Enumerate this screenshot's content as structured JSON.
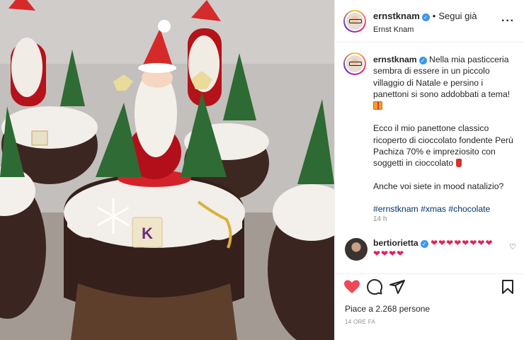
{
  "post": {
    "author": {
      "username": "ernstknam",
      "display_name": "Ernst Knam",
      "verified": true
    },
    "follow_label": "Segui già",
    "separator": "•",
    "more_icon": "more-horizontal-icon",
    "caption": {
      "paragraph_1": "Nella mia pasticceria sembra di essere in un piccolo villaggio di Natale e persino i panettoni si sono addobbati a tema!",
      "paragraph_2": "Ecco il mio panettone classico ricoperto di cioccolato fondente Perù Pachiza 70% e impreziosito con soggetti in cioccolato",
      "paragraph_3": "Anche voi siete in mood natalizio?",
      "hashtags": [
        "#ernstknam",
        "#xmas",
        "#chocolate"
      ],
      "time": "14 h"
    },
    "comment": {
      "username": "bertiorietta",
      "verified": true,
      "text": "❤❤❤❤❤❤❤❤❤❤❤❤"
    },
    "actions": {
      "like_icon": "heart-filled-icon",
      "comment_icon": "comment-icon",
      "share_icon": "send-icon",
      "save_icon": "bookmark-icon"
    },
    "likes_text": "Piace a 2.268 persone",
    "date_text": "14 ORE FA",
    "colors": {
      "like_red": "#ed4956",
      "link_blue": "#00376b",
      "verified_blue": "#3897f0",
      "muted_gray": "#8e8e8e"
    }
  },
  "photo": {
    "description_icon": "panettone-photo",
    "label_text": "K"
  }
}
